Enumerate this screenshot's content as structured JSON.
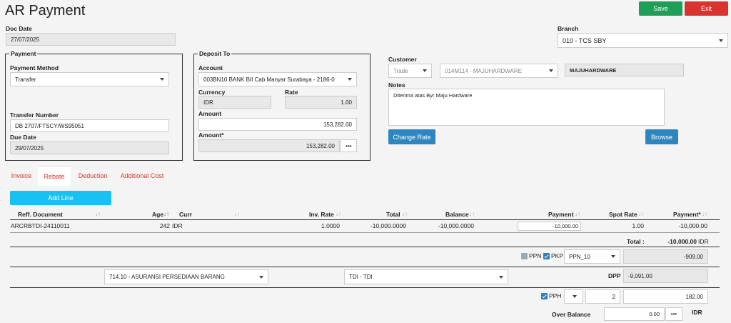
{
  "page": {
    "title": "AR Payment"
  },
  "toolbar": {
    "save_label": "Save",
    "exit_label": "Exit"
  },
  "doc": {
    "date_label": "Doc Date",
    "date_value": "27/07/2025"
  },
  "branch": {
    "label": "Branch",
    "value": "010 - TCS SBY"
  },
  "payment": {
    "legend": "Payment",
    "method_label": "Payment Method",
    "method_value": "Transfer",
    "transfer_label": "Transfer Number",
    "transfer_value": "DB 2707/FTSCY/WS95051",
    "due_label": "Due Date",
    "due_value": "29/07/2025"
  },
  "deposit": {
    "legend": "Deposit To",
    "account_label": "Account",
    "account_value": "003BN10 BANK BII Cab Manyar Surabaya - 2186-0",
    "currency_label": "Currency",
    "currency_value": "IDR",
    "rate_label": "Rate",
    "rate_value": "1.00",
    "amount_label": "Amount",
    "amount_value": "153,282.00",
    "amount2_label": "Amount*",
    "amount2_value": "153,282.00",
    "more": "•••"
  },
  "customer": {
    "label": "Customer",
    "type_value": "Trade",
    "code_value": "014M114 - MAJUHARDWARE",
    "name_value": "MAJUHARDWARE",
    "notes_label": "Notes",
    "notes_value": "Diterima atas Byr Maju Hardware",
    "change_rate_label": "Change Rate",
    "browse_label": "Browse"
  },
  "tabs": [
    {
      "label": "Invoice"
    },
    {
      "label": "Rebate"
    },
    {
      "label": "Deduction"
    },
    {
      "label": "Additional Cost"
    }
  ],
  "grid": {
    "add_line_label": "Add Line",
    "headers": [
      "Reff. Document",
      "Age",
      "Curr",
      "Inv. Rate",
      "Total",
      "Balance",
      "Payment",
      "Spot Rate",
      "Payment*"
    ],
    "row": {
      "reff": "ARCRBTDI-24110011",
      "age": "242",
      "curr": "IDR",
      "inv_rate": "1.0000",
      "total": "-10,000.0000",
      "balance": "-10,000.0000",
      "payment": "-10,000.00",
      "spot_rate": "1.00",
      "payment_star": "-10,000.00"
    },
    "total_label": "Total :",
    "total_value": "-10,000.00",
    "total_currency": "IDR"
  },
  "tax": {
    "ppn_label": "PPN",
    "pkp_label": "PKP",
    "ppn_code": "PPN_10",
    "ppn_value": "-909.00",
    "account_value": "714.10 - ASURANSI PERSEDIAAN BARANG",
    "tdi_value": "TDI - TDI",
    "dpp_label": "DPP",
    "dpp_value": "-9,091.00",
    "pph_label": "PPH",
    "pph_rate": "2",
    "pph_value": "182.00",
    "over_label": "Over Balance",
    "over_value": "0.00",
    "over_currency": "IDR",
    "more": "•••"
  },
  "colors": {
    "save": "#1e9e57",
    "exit": "#d9332e",
    "accent": "#2e86c1",
    "add_line": "#17c2f0"
  }
}
